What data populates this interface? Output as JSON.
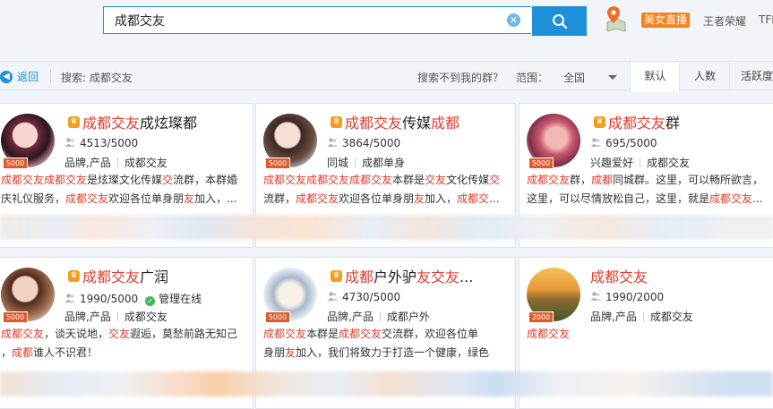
{
  "search": {
    "value": "成都交友"
  },
  "header": {
    "live_badge": "美女直播",
    "link1": "王者荣耀",
    "link2": "TFB"
  },
  "subbar": {
    "back": "返回",
    "search_label": "搜索: 成都交友",
    "not_found": "搜索不到我的群？",
    "range_label": "范围：",
    "range_value": "全国"
  },
  "tabs": [
    {
      "label": "默认"
    },
    {
      "label": "人数"
    },
    {
      "label": "活跃度"
    }
  ],
  "cards": [
    {
      "title_hl": "成都交友",
      "title_rest": "成炫璨都",
      "members": "4513/5000",
      "tag1": "品牌,产品",
      "tag2": "成都交友",
      "level": "5000",
      "desc1": [
        [
          "成都交友",
          1
        ],
        [
          "成都交友",
          1
        ],
        [
          "是炫璨文化传媒",
          0
        ],
        [
          "交",
          1
        ],
        [
          "流群，本群婚",
          0
        ]
      ],
      "desc2": [
        [
          "庆礼仪服务，",
          0
        ],
        [
          "成都交友",
          1
        ],
        [
          "欢迎各位单身朋",
          0
        ],
        [
          "友",
          1
        ],
        [
          "加入，...",
          0
        ]
      ]
    },
    {
      "title_hl": "成都交友",
      "title_rest": "传媒",
      "title_hl2": "成都",
      "members": "3864/5000",
      "tag1": "同城",
      "tag2": "成都单身",
      "level": "5000",
      "desc1": [
        [
          "成都交友",
          1
        ],
        [
          "成都交友",
          1
        ],
        [
          "成都交友",
          1
        ],
        [
          "本群是",
          0
        ],
        [
          "交友",
          1
        ],
        [
          "文化传媒",
          0
        ],
        [
          "交",
          1
        ]
      ],
      "desc2": [
        [
          "流群，",
          0
        ],
        [
          "成都交友",
          1
        ],
        [
          "欢迎各位单身朋",
          0
        ],
        [
          "友",
          1
        ],
        [
          "加入，",
          0
        ],
        [
          "成都交",
          1
        ],
        [
          "...",
          0
        ]
      ]
    },
    {
      "title_hl": "成都交友",
      "title_rest": "群",
      "members": "695/5000",
      "tag1": "兴趣爱好",
      "tag2": "成都交友",
      "level": "5000",
      "desc1": [
        [
          "成都交友",
          1
        ],
        [
          "群，",
          0
        ],
        [
          "成都",
          1
        ],
        [
          "同城群。这里，可以畅所欲言，",
          0
        ]
      ],
      "desc2": [
        [
          "这里，可以尽情放松自己，这里，就是",
          0
        ],
        [
          "成都交友",
          1
        ],
        [
          "...",
          0
        ]
      ]
    },
    {
      "title_hl": "成都交友",
      "title_rest": "广润",
      "members": "1990/5000",
      "managed": "管理在线",
      "tag1": "品牌,产品",
      "tag2": "成都交友",
      "level": "5000",
      "desc1": [
        [
          "成都交友",
          1
        ],
        [
          "，谈天说地，",
          0
        ],
        [
          "交友",
          1
        ],
        [
          "遐逅，莫愁前路无知己",
          0
        ]
      ],
      "desc2": [
        [
          "，",
          0
        ],
        [
          "成都",
          1
        ],
        [
          "谁人不识君！",
          0
        ]
      ]
    },
    {
      "title_hl": "成都",
      "title_rest": "户外驴",
      "title_hl2": "友交友",
      "title_tail": "...",
      "members": "4730/5000",
      "tag1": "品牌,产品",
      "tag2": "成都户外",
      "level": "5000",
      "desc1": [
        [
          "成都交友",
          1
        ],
        [
          "本群是",
          0
        ],
        [
          "成都交友",
          1
        ],
        [
          "交流群，欢迎各位单",
          0
        ]
      ],
      "desc2": [
        [
          "身朋",
          0
        ],
        [
          "友",
          1
        ],
        [
          "加入，我们将致力于打造一个健康，绿色",
          0
        ]
      ]
    },
    {
      "title_hl": "成都交友",
      "title_rest": "",
      "members": "1990/2000",
      "tag1": "品牌,产品",
      "tag2": "成都交友",
      "level": "2000",
      "desc1": [
        [
          "成都交友",
          1
        ]
      ],
      "desc2": []
    }
  ]
}
